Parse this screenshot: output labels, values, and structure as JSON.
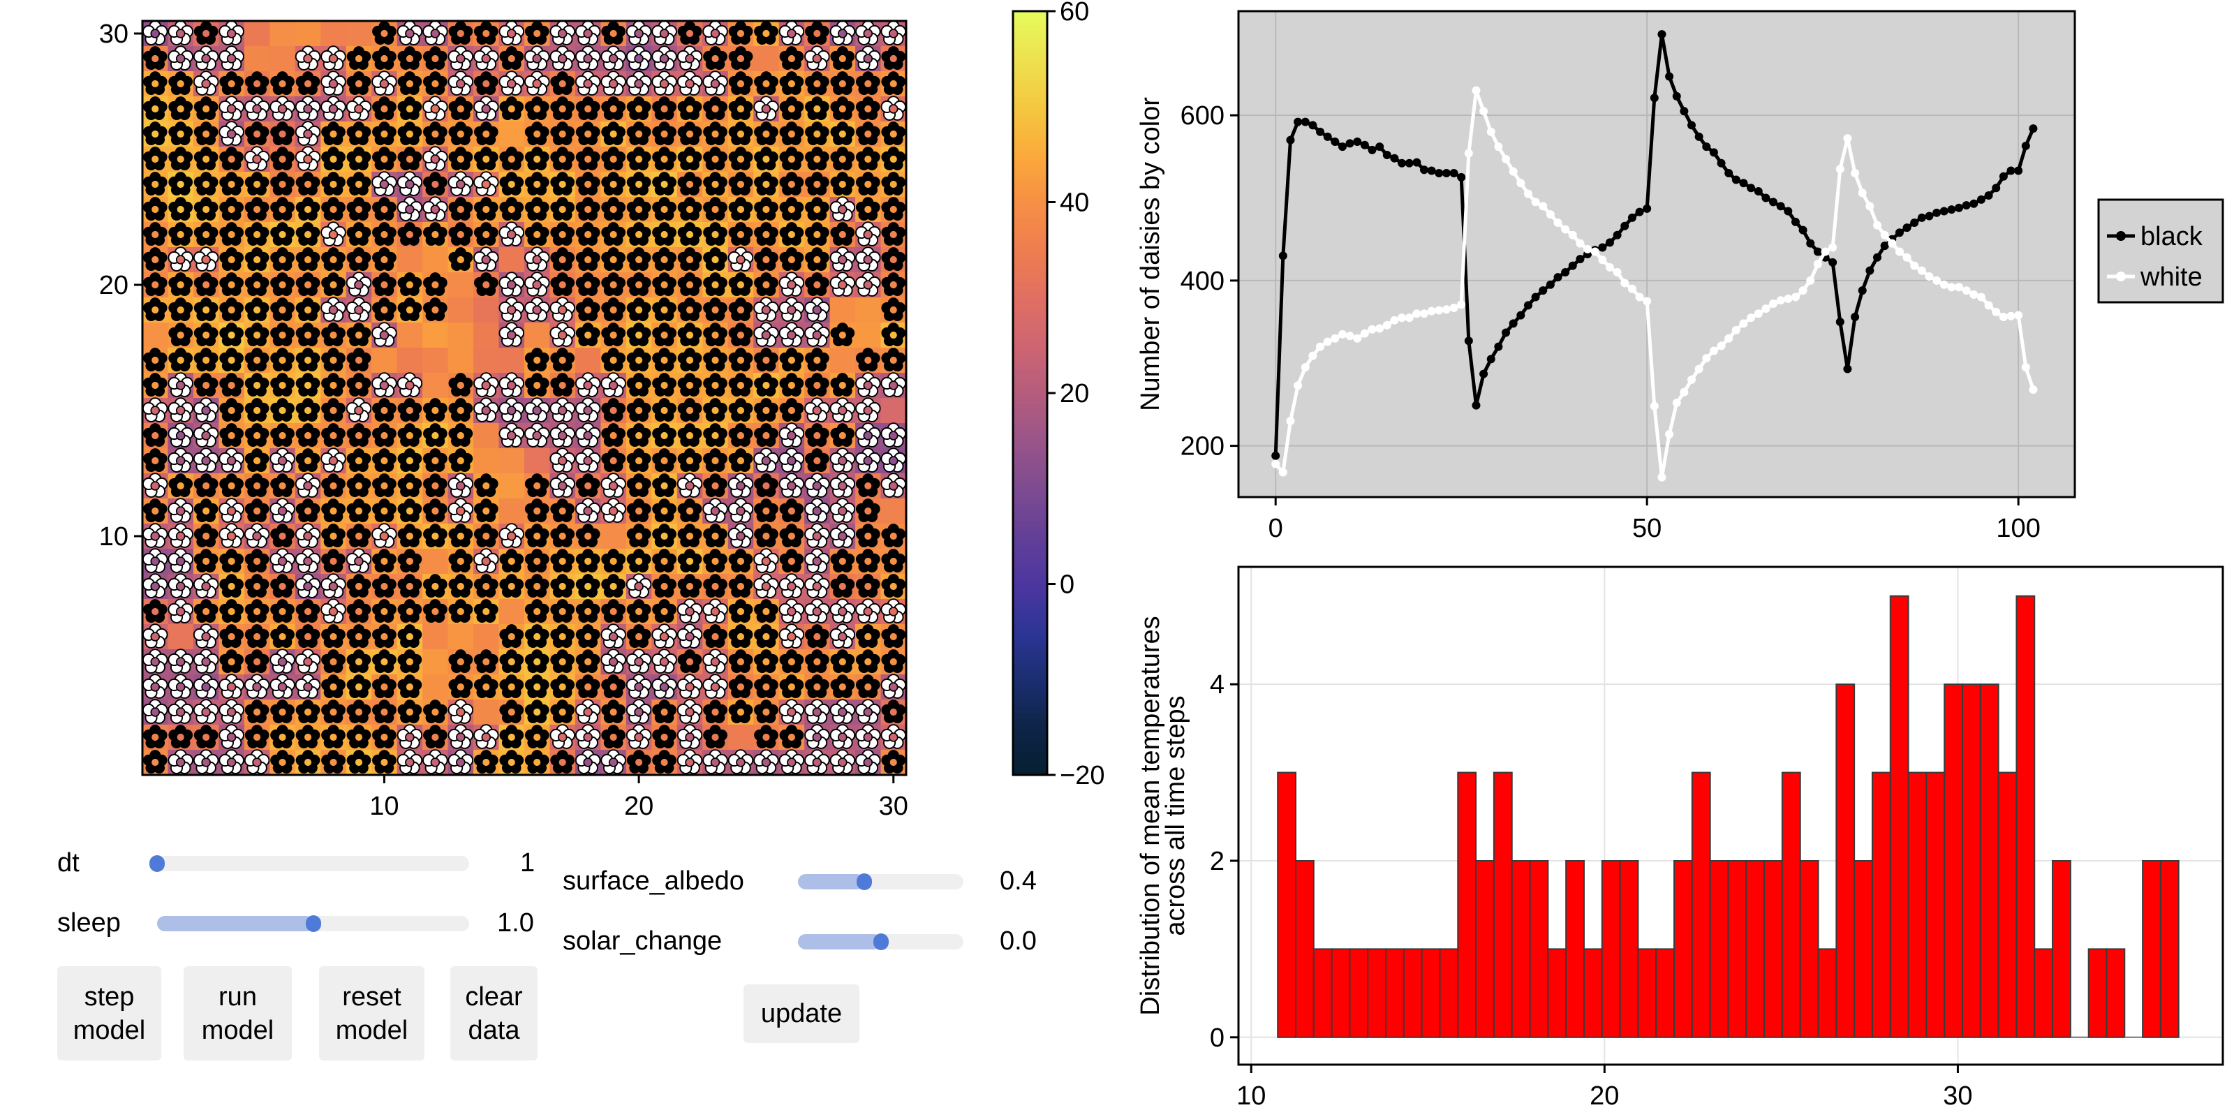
{
  "heatmap": {
    "xticks": [
      10,
      20,
      30
    ],
    "yticks": [
      10,
      20,
      30
    ],
    "legend_codes": {
      "B": "black daisy",
      "W": "white daisy",
      ".": "empty"
    },
    "rows_top_to_bottom": [
      "WWBW.....BWWBBWBWWBWWBWBBWBWWW",
      "BWWW..WWBBBBWWBWWWWWWWBB.BWBWB",
      "BBWBBBBWBWBBWBWWBWWWWWWBBBBBBB",
      "BBBWWWWWWBBWBWBBBBBBBBBBWBBBBW",
      "BBBWBBWBBBBBBB.BBBBBBBBBBBBBBB",
      "BBBBWBWBBBBWBBBBBBBBBBBBBBBBBB",
      "BBBBBBBBBWWBWWBBBBBBBBBBBBBBBB",
      "BBBBBBBBBBWWBBBBBBBBBBBBBBBWBB",
      "BBBBBBBWBBBBBBWBBBBBBBBBBBBBWB",
      "BWWBBBBBBB..BW.WBBBBBBBWBBBWWB",
      "BBBBBBBBWBBB.BWWBBBBBBBBBWBWWB",
      "BBBBBBBWWBBB..WWWBBBBBBBWWW..B",
      ".BBBBBBBBW....W.WBBBBBBBWWWB.B",
      "BBBBBBBBB......BB.BBBBBBBBB.BB",
      "BWBBBBBBBWW.BWWBBWWBBBBBBBBBWW",
      "WWWBBBBBWBBBBWWWWWBBBBBBBBWWW.",
      "BWWBBBBBBBBBB.WWWWBBBBBBBWBBWW",
      "BWWWBWBWBBBBB...WWBBBBBBWWBWWW",
      "WBBBBBWBBBBBWB.BWBWBBWBWBWWWBW",
      "BWBWBWBBBBBBWB.BBWWBBBWWBBWWB.",
      "WWBWWBWBBWBBBBWBBB.BBBBWBBWWBB",
      "WWBBBWWBWBB.BWBBBBBBBBBBWBWBBB",
      "WWWBBBWWBBBBBBBBBBBWBBBBWWWBBB",
      "BWBBBBBWBBBBBB.BBBBBBWWBBWWWWW",
      "W.WBBBBBBBB...BBBBWBWWBBBWBWBB",
      "WWWBBWWBBBB.BBBBBBWWWBWBBBBBBB",
      "WWWWWWWBBBB.BBBBBBBWWWWBBBBBBW",
      "WWWWBBBBBBBBW.BBBWBWBWBBBWWWWB",
      "BBBWBBBBBBWBWWBBWWBWBWB.BBWWWW",
      "BWWWWBBBBBWWWBBBBWWBBWWWWWWWWB"
    ]
  },
  "colorbar": {
    "range": [
      -20,
      60
    ],
    "ticks": [
      "60",
      "40",
      "20",
      "0",
      "−20"
    ],
    "tick_values": [
      60,
      40,
      20,
      0,
      -20
    ],
    "colormap": [
      [
        -20,
        "#061f30"
      ],
      [
        -15,
        "#0d2447"
      ],
      [
        -10,
        "#1a2e6f"
      ],
      [
        -5,
        "#2c3595"
      ],
      [
        0,
        "#4b36a0"
      ],
      [
        5,
        "#623f98"
      ],
      [
        10,
        "#7d4b91"
      ],
      [
        15,
        "#985489"
      ],
      [
        20,
        "#b45c7d"
      ],
      [
        25,
        "#cd6572"
      ],
      [
        30,
        "#e06f63"
      ],
      [
        35,
        "#ee7d50"
      ],
      [
        40,
        "#f68f45"
      ],
      [
        45,
        "#fba93b"
      ],
      [
        50,
        "#f5c740"
      ],
      [
        55,
        "#eee04f"
      ],
      [
        60,
        "#e6fb5c"
      ]
    ]
  },
  "chart_data": [
    {
      "type": "line",
      "ylabel": "Number of daisies by color",
      "xlabel": "",
      "xlim": [
        -5,
        107.6
      ],
      "ylim": [
        138,
        726
      ],
      "xticks": [
        0,
        50,
        100
      ],
      "yticks": [
        200,
        400,
        600
      ],
      "grid": true,
      "background": "#d3d3d3",
      "legend_placement": "right",
      "series": [
        {
          "name": "black",
          "color": "#000000",
          "x_start": 0,
          "values": [
            188,
            430,
            570,
            592,
            592,
            588,
            580,
            574,
            568,
            562,
            566,
            568,
            564,
            558,
            562,
            552,
            548,
            542,
            542,
            543,
            534,
            533,
            530,
            530,
            530,
            525,
            327,
            249,
            287,
            305,
            320,
            337,
            348,
            358,
            370,
            380,
            388,
            395,
            404,
            410,
            418,
            426,
            432,
            437,
            440,
            446,
            455,
            466,
            476,
            483,
            487,
            621,
            698,
            647,
            623,
            605,
            588,
            574,
            562,
            555,
            542,
            530,
            522,
            518,
            512,
            508,
            500,
            495,
            490,
            484,
            471,
            461,
            445,
            435,
            428,
            422,
            350,
            293,
            356,
            388,
            412,
            428,
            442,
            450,
            458,
            464,
            470,
            476,
            478,
            482,
            484,
            486,
            488,
            491,
            493,
            498,
            503,
            512,
            526,
            533,
            533,
            563,
            584
          ]
        },
        {
          "name": "white",
          "color": "#ffffff",
          "x_start": 0,
          "values": [
            178,
            168,
            230,
            273,
            295,
            309,
            320,
            326,
            330,
            335,
            333,
            330,
            336,
            341,
            342,
            346,
            352,
            355,
            355,
            360,
            360,
            363,
            364,
            365,
            367,
            371,
            554,
            630,
            605,
            580,
            562,
            547,
            532,
            518,
            505,
            495,
            490,
            480,
            470,
            462,
            455,
            445,
            438,
            435,
            425,
            416,
            410,
            397,
            390,
            380,
            375,
            248,
            162,
            214,
            252,
            265,
            280,
            293,
            306,
            315,
            321,
            330,
            340,
            348,
            355,
            360,
            366,
            372,
            376,
            378,
            380,
            388,
            400,
            420,
            435,
            440,
            535,
            572,
            530,
            506,
            490,
            467,
            455,
            445,
            435,
            428,
            418,
            412,
            405,
            400,
            395,
            392,
            392,
            388,
            383,
            380,
            370,
            362,
            356,
            357,
            358,
            295,
            268
          ]
        }
      ]
    },
    {
      "type": "bar",
      "ylabel": "Distribution of mean temperatures\nacross all time steps",
      "ylabel_lines": [
        "Distribution of mean temperatures",
        "across all time steps"
      ],
      "xlabel": "",
      "xlim": [
        9.64,
        37.5
      ],
      "ylim": [
        -0.31,
        5.33
      ],
      "xticks": [
        10,
        20,
        30
      ],
      "yticks": [
        0,
        2,
        4
      ],
      "grid": true,
      "bar_color": "#ff0000",
      "bin_start": 10.75,
      "bin_width": 0.51,
      "values": [
        3,
        2,
        1,
        1,
        1,
        1,
        1,
        1,
        1,
        1,
        3,
        2,
        3,
        2,
        2,
        1,
        2,
        1,
        2,
        2,
        1,
        1,
        2,
        3,
        2,
        2,
        2,
        2,
        3,
        2,
        1,
        4,
        2,
        3,
        5,
        3,
        3,
        4,
        4,
        4,
        3,
        5,
        1,
        2,
        0,
        1,
        1,
        0,
        2,
        2
      ]
    }
  ],
  "controls": {
    "dt": {
      "label": "dt",
      "value": "1",
      "fraction": 0.0
    },
    "sleep": {
      "label": "sleep",
      "value": "1.0",
      "fraction": 0.5
    },
    "surface_albedo": {
      "label": "surface_albedo",
      "value": "0.4",
      "fraction": 0.4
    },
    "solar_change": {
      "label": "solar_change",
      "value": "0.0",
      "fraction": 0.5
    },
    "buttons": {
      "step": [
        "step",
        "model"
      ],
      "run": [
        "run",
        "model"
      ],
      "reset": [
        "reset",
        "model"
      ],
      "clear": [
        "clear",
        "data"
      ],
      "update": "update"
    },
    "accent": "#4f7bd8",
    "accent_light": "#adbfe6"
  }
}
